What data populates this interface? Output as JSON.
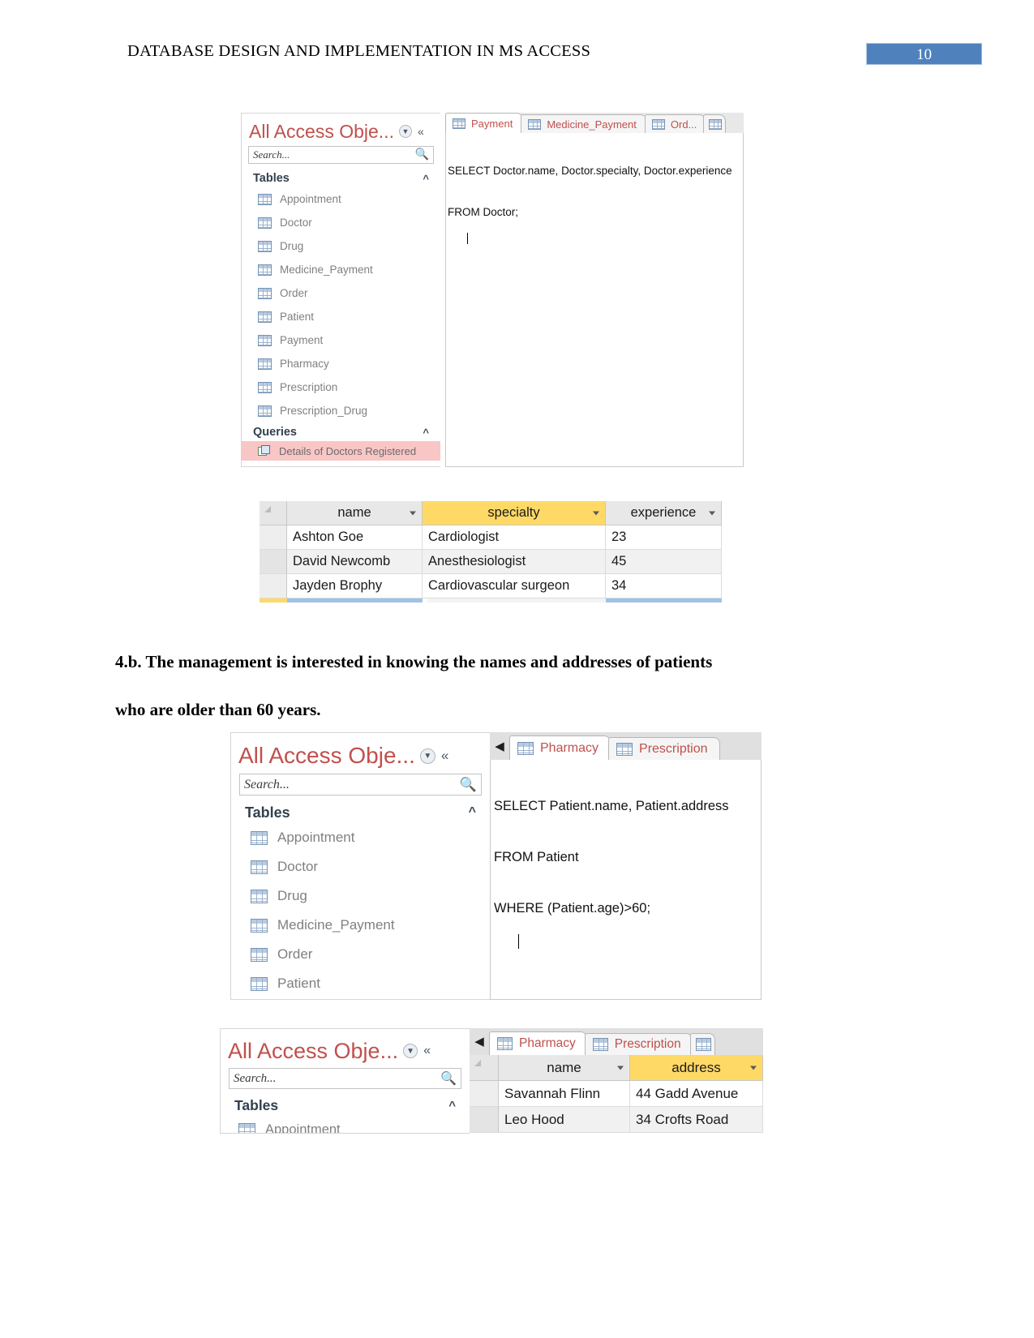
{
  "document": {
    "header_title": "DATABASE DESIGN AND IMPLEMENTATION IN MS ACCESS",
    "page_number": "10",
    "paragraph_line1": "4.b. The management is interested in knowing the names and addresses of patients",
    "paragraph_line2": "who are older than 60 years."
  },
  "colors": {
    "page_badge_bg": "#4f81bd",
    "nav_title": "#c0504d",
    "tab_label": "#c0504d",
    "selected_header": "#ffd966",
    "query_selected_row": "#f9c6c6"
  },
  "screenshot1": {
    "nav_pane": {
      "title": "All Access Obje...",
      "caret_icon": "chevron-down-circle-icon",
      "collapse_icon": "double-chevron-left-icon",
      "search_placeholder": "Search...",
      "search_value": "",
      "search_icon": "magnifier-icon",
      "groups": [
        {
          "label": "Tables",
          "collapse_icon": "double-chevron-up-icon",
          "items": [
            "Appointment",
            "Doctor",
            "Drug",
            "Medicine_Payment",
            "Order",
            "Patient",
            "Payment",
            "Pharmacy",
            "Prescription",
            "Prescription_Drug"
          ]
        },
        {
          "label": "Queries",
          "collapse_icon": "double-chevron-up-icon",
          "items": [
            "Details of Doctors Registered"
          ]
        }
      ]
    },
    "tabs": [
      {
        "label": "Payment",
        "icon": "table-icon"
      },
      {
        "label": "Medicine_Payment",
        "icon": "table-icon"
      },
      {
        "label": "Ord...",
        "icon": "table-icon"
      },
      {
        "label": "",
        "icon": "table-icon"
      }
    ],
    "sql_line1": "SELECT Doctor.name, Doctor.specialty, Doctor.experience",
    "sql_line2": "FROM Doctor;"
  },
  "results1": {
    "columns": [
      {
        "label": "name",
        "selected": false,
        "dropdown_icon": "chevron-down-icon"
      },
      {
        "label": "specialty",
        "selected": true,
        "dropdown_icon": "chevron-down-icon"
      },
      {
        "label": "experience",
        "selected": false,
        "dropdown_icon": "chevron-down-icon"
      }
    ],
    "rows": [
      [
        "Ashton Goe",
        "Cardiologist",
        "23"
      ],
      [
        "David Newcomb",
        "Anesthesiologist",
        "45"
      ],
      [
        "Jayden Brophy",
        "Cardiovascular surgeon",
        "34"
      ]
    ]
  },
  "screenshot2": {
    "nav_pane": {
      "title": "All Access Obje...",
      "caret_icon": "chevron-down-circle-icon",
      "collapse_icon": "double-chevron-left-icon",
      "search_placeholder": "Search...",
      "search_value": "",
      "search_icon": "magnifier-icon",
      "groups": [
        {
          "label": "Tables",
          "collapse_icon": "double-chevron-up-icon",
          "items": [
            "Appointment",
            "Doctor",
            "Drug",
            "Medicine_Payment",
            "Order",
            "Patient"
          ]
        }
      ]
    },
    "tab_scroll_icon": "triangle-left-icon",
    "tabs": [
      {
        "label": "Pharmacy",
        "icon": "table-icon"
      },
      {
        "label": "Prescription",
        "icon": "table-icon"
      }
    ],
    "sql_line1": "SELECT Patient.name, Patient.address",
    "sql_line2": "FROM Patient",
    "sql_line3": "WHERE (Patient.age)>60;"
  },
  "screenshot3": {
    "nav_pane": {
      "title": "All Access Obje...",
      "caret_icon": "chevron-down-circle-icon",
      "collapse_icon": "double-chevron-left-icon",
      "search_placeholder": "Search...",
      "search_value": "",
      "search_icon": "magnifier-icon",
      "groups": [
        {
          "label": "Tables",
          "collapse_icon": "double-chevron-up-icon",
          "items": [
            "Appointment"
          ]
        }
      ]
    },
    "tab_scroll_icon": "triangle-left-icon",
    "tabs": [
      {
        "label": "Pharmacy",
        "icon": "table-icon"
      },
      {
        "label": "Prescription",
        "icon": "table-icon"
      },
      {
        "label": "",
        "icon": "table-icon"
      }
    ],
    "results": {
      "columns": [
        {
          "label": "name",
          "selected": false,
          "dropdown_icon": "chevron-down-icon"
        },
        {
          "label": "address",
          "selected": true,
          "dropdown_icon": "chevron-down-icon"
        }
      ],
      "rows": [
        [
          "Savannah Flinn",
          "44 Gadd Avenue"
        ],
        [
          "Leo Hood",
          "34 Crofts Road"
        ]
      ]
    }
  }
}
